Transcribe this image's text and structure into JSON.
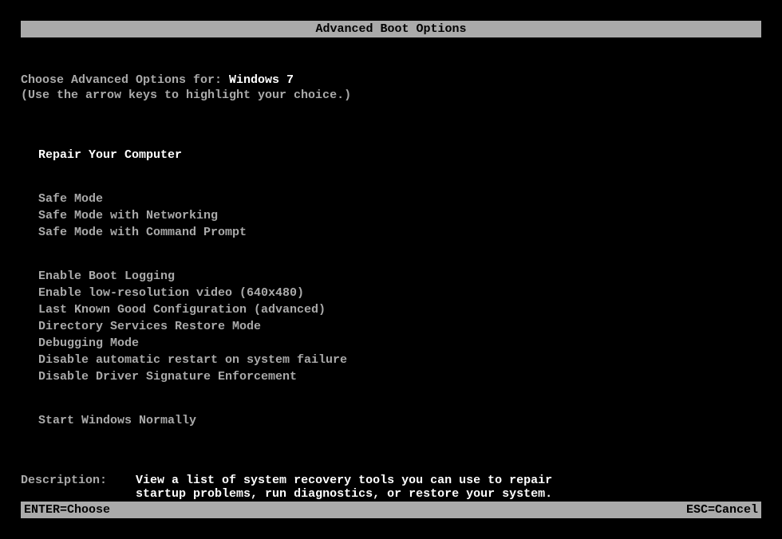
{
  "title": "Advanced Boot Options",
  "prompt_prefix": "Choose Advanced Options for: ",
  "os_name": "Windows 7",
  "hint": "(Use the arrow keys to highlight your choice.)",
  "groups": {
    "g0": {
      "item0": "Repair Your Computer"
    },
    "g1": {
      "item0": "Safe Mode",
      "item1": "Safe Mode with Networking",
      "item2": "Safe Mode with Command Prompt"
    },
    "g2": {
      "item0": "Enable Boot Logging",
      "item1": "Enable low-resolution video (640x480)",
      "item2": "Last Known Good Configuration (advanced)",
      "item3": "Directory Services Restore Mode",
      "item4": "Debugging Mode",
      "item5": "Disable automatic restart on system failure",
      "item6": "Disable Driver Signature Enforcement"
    },
    "g3": {
      "item0": "Start Windows Normally"
    }
  },
  "description_label": "Description:    ",
  "description_text": "View a list of system recovery tools you can use to repair startup problems, run diagnostics, or restore your system.",
  "status_left": "ENTER=Choose",
  "status_right": "ESC=Cancel"
}
